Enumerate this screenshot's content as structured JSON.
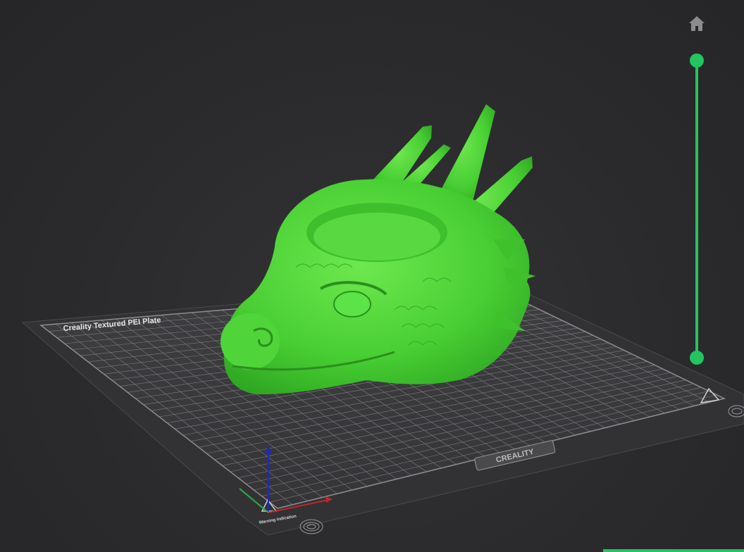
{
  "viewport": {
    "background": "#2b2b2d",
    "accent": "#22c55e"
  },
  "build_plate": {
    "label": "Creality Textured PEI Plate",
    "brand": "CREALITY",
    "warning_text": "Warning Indication",
    "color": "#3b3b3e",
    "grid_color": "#9a9a9e"
  },
  "model": {
    "color": "#4cd33a",
    "icon": "dragon-head-model"
  },
  "controls": {
    "home_icon": "home-icon",
    "layer_slider_icon": "vertical-layer-slider"
  },
  "axes": {
    "x_color": "#c0262b",
    "y_color": "#2fae4a",
    "z_color": "#1f2bb0"
  }
}
